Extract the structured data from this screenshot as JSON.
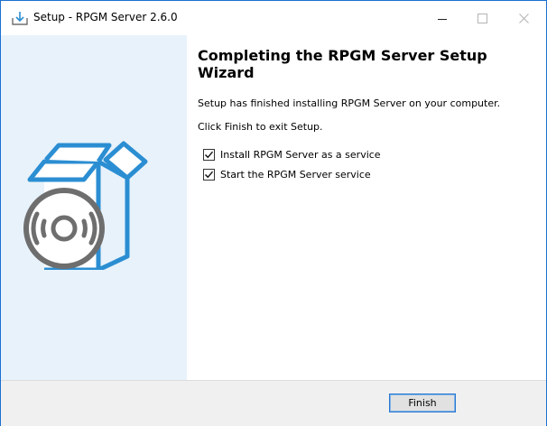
{
  "window": {
    "title": "Setup - RPGM Server 2.6.0",
    "icons": {
      "app": "installer-download-icon",
      "minimize": "minimize-icon",
      "maximize": "maximize-icon",
      "close": "close-icon"
    }
  },
  "side_panel": {
    "background": "#e8f2fb",
    "illustration": "box-with-disc-icon",
    "accent": "#2b8ed2",
    "disc_color": "#6e6e6e"
  },
  "content": {
    "heading": "Completing the RPGM Server Setup Wizard",
    "message": "Setup has finished installing RPGM Server on your computer.",
    "instruction": "Click Finish to exit Setup.",
    "options": [
      {
        "label": "Install RPGM Server as a service",
        "checked": true
      },
      {
        "label": "Start the RPGM Server service",
        "checked": true
      }
    ]
  },
  "footer": {
    "finish_label": "Finish"
  }
}
